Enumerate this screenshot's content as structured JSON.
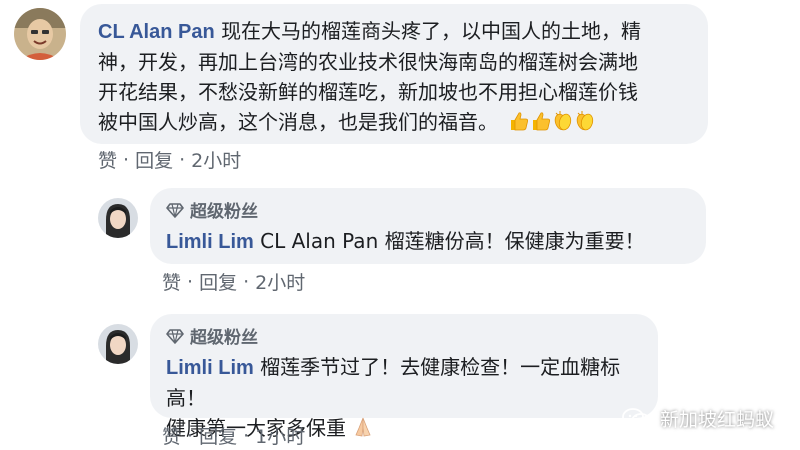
{
  "comments": [
    {
      "author": "CL Alan Pan",
      "text_lines": [
        "现在大马的榴莲商头疼了，以中国人的土地，精",
        "神，开发，再加上台湾的农业技术很快海南岛的榴莲树会满地",
        "开花结果，不愁没新鲜的榴莲吃，新加坡也不用担心榴莲价钱",
        "被中国人炒高，这个消息，也是我们的福音。"
      ],
      "reactions_emoji": [
        "thumbs-up",
        "thumbs-up",
        "clapping-hands",
        "clapping-hands"
      ],
      "like_label": "赞",
      "reply_label": "回复",
      "time": "2小时",
      "separator": "·"
    },
    {
      "badge": "超级粉丝",
      "author": "Limli Lim",
      "text_lines": [
        "CL Alan Pan 榴莲糖份高！保健康为重要！"
      ],
      "like_label": "赞",
      "reply_label": "回复",
      "time": "2小时",
      "separator": "·"
    },
    {
      "badge": "超级粉丝",
      "author": "Limli Lim",
      "text_lines": [
        "榴莲季节过了！去健康检查！一定血糖标高！",
        "健康第一大家多保重"
      ],
      "trailing_emoji": "folded-hands",
      "like_label": "赞",
      "reply_label": "回复",
      "time": "1小时",
      "separator": "·"
    }
  ],
  "watermark": {
    "text": "新加坡红蚂蚁",
    "icon": "wechat-icon"
  },
  "colors": {
    "bubble": "#f0f2f5",
    "author": "#385898",
    "meta": "#606770"
  }
}
